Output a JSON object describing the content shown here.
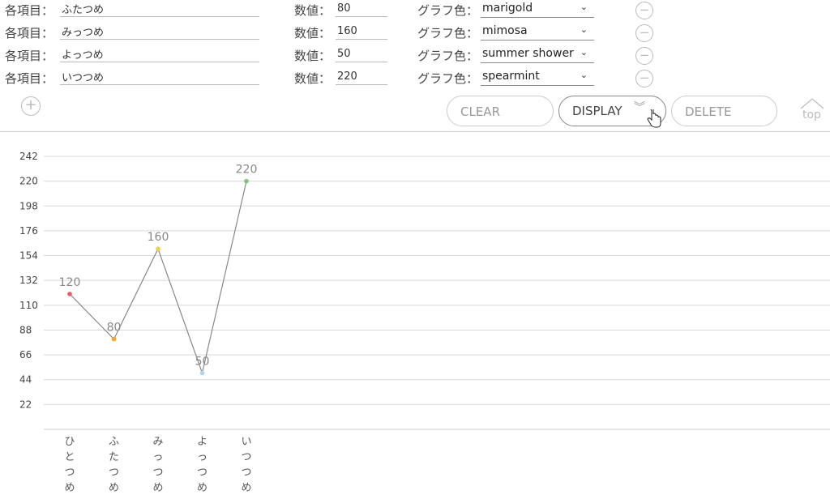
{
  "form": {
    "item_label": "各項目：",
    "value_label": "数値：",
    "color_label": "グラフ色：",
    "rows": [
      {
        "name": "ふたつめ",
        "value": "80",
        "color": "marigold"
      },
      {
        "name": "みっつめ",
        "value": "160",
        "color": "mimosa"
      },
      {
        "name": "よっつめ",
        "value": "50",
        "color": "summer shower"
      },
      {
        "name": "いつつめ",
        "value": "220",
        "color": "spearmint"
      }
    ],
    "remove_icon": "minus-circle-icon",
    "add_icon": "plus-circle-icon"
  },
  "buttons": {
    "clear": "CLEAR",
    "display": "DISPLAY",
    "delete": "DELETE",
    "top": "top"
  },
  "chart_data": {
    "type": "line",
    "categories": [
      "ひとつめ",
      "ふたつめ",
      "みっつめ",
      "よっつめ",
      "いつつめ"
    ],
    "values": [
      120,
      80,
      160,
      50,
      220
    ],
    "point_colors": [
      "#e35d6a",
      "#f2a33a",
      "#f0d24a",
      "#a8d8ea",
      "#7cc47a"
    ],
    "yticks": [
      22,
      44,
      66,
      88,
      110,
      132,
      154,
      176,
      198,
      220,
      242
    ],
    "ylim": [
      0,
      242
    ],
    "line_color": "#888888",
    "grid": true
  }
}
